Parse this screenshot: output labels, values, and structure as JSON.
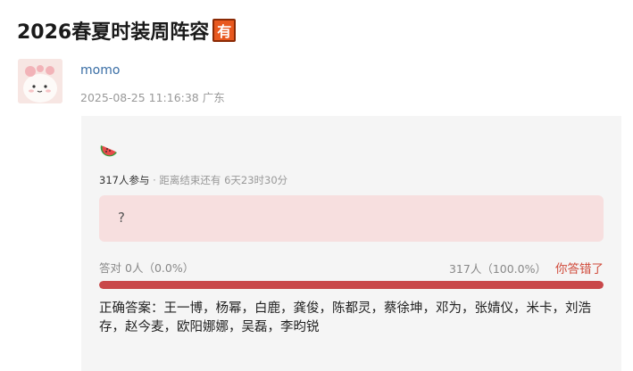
{
  "post": {
    "title": "2026春夏时装周阵容",
    "badge": "有"
  },
  "author": {
    "name": "momo",
    "timestamp": "2025-08-25 11:16:38",
    "location": "广东"
  },
  "poll": {
    "icon": "watermelon-icon",
    "participants": "317人参与",
    "separator": "·",
    "deadline": "距离结束还有 6天23时30分",
    "option_text": "?",
    "correct_label": "答对",
    "correct_count": "0人（0.0%）",
    "total_result": "317人（100.0%）",
    "wrong_label": "你答错了",
    "wrong_fraction": 1.0,
    "answer": "正确答案：王一博，杨幂，白鹿，龚俊，陈都灵，蔡徐坤，邓为，张婧仪，米卡，刘浩存，赵今麦，欧阳娜娜，吴磊，李昀锐",
    "colors": {
      "bar": "#c9484a",
      "option_bg": "#f7dfdf",
      "wrong": "#d04a3a",
      "badge": "#e8581e"
    }
  }
}
